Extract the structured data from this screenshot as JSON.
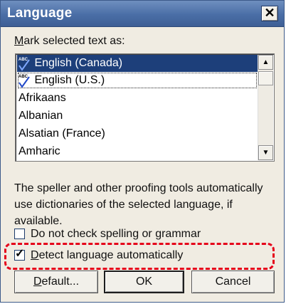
{
  "window": {
    "title": "Language",
    "close_glyph": "✕"
  },
  "list": {
    "label_prefix": "M",
    "label_rest": "ark selected text as:",
    "items": [
      {
        "label": "English (Canada)",
        "spell_icon": "abc-check-icon",
        "selected": true
      },
      {
        "label": "English (U.S.)",
        "spell_icon": "abc-check-icon",
        "selected": false
      },
      {
        "label": "Afrikaans"
      },
      {
        "label": "Albanian"
      },
      {
        "label": "Alsatian (France)"
      },
      {
        "label": "Amharic"
      }
    ],
    "scroll_up_glyph": "▲",
    "scroll_down_glyph": "▼"
  },
  "description": "The speller and other proofing tools automatically use dictionaries of the selected language, if available.",
  "options": {
    "no_check": {
      "label": "Do not check spelling or grammar",
      "checked": false
    },
    "detect": {
      "label_prefix": "D",
      "label_rest": "etect language automatically",
      "checked": true,
      "check_glyph": "✓"
    }
  },
  "buttons": {
    "default_prefix": "D",
    "default_rest": "efault...",
    "ok": "OK",
    "cancel": "Cancel"
  },
  "colors": {
    "selection": "#1d3f7a",
    "highlight": "#e5001a",
    "titlebar": "#4a6ea6"
  }
}
